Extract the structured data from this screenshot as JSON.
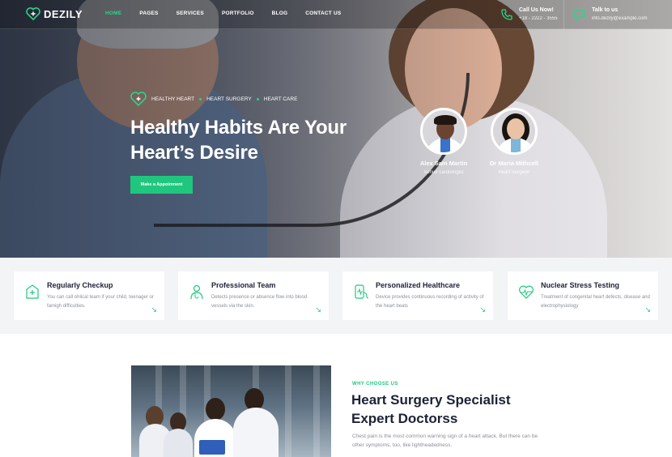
{
  "brand": {
    "name": "DEZILY"
  },
  "nav": {
    "items": [
      {
        "label": "HOME",
        "active": true
      },
      {
        "label": "PAGES"
      },
      {
        "label": "SERVICES"
      },
      {
        "label": "PORTFOLIO"
      },
      {
        "label": "BLOG"
      },
      {
        "label": "CONTACT US"
      }
    ]
  },
  "contact": {
    "phone": {
      "title": "Call Us Now!",
      "value": "+18 - 2222 - 3555",
      "icon": "phone-icon"
    },
    "email": {
      "title": "Talk to us",
      "value": "info.dezily@example.com",
      "icon": "chat-icon"
    }
  },
  "hero": {
    "crumbs": [
      "HEALTHY HEART",
      "HEART SURGERY",
      "HEART CARE"
    ],
    "title_line1": "Healthy Habits Are Your",
    "title_line2": "Heart’s Desire",
    "cta": "Make a Appoinment",
    "doctors": [
      {
        "name": "Alex Sam Martin",
        "role": "Senior cardiologist"
      },
      {
        "name": "Dr Maria Mithcell",
        "role": "Heart Surgeon"
      }
    ]
  },
  "features": [
    {
      "title": "Regularly Checkup",
      "desc": "You can call ohlical team if your child, teenager or famigh difficulties.",
      "icon": "checkup-icon"
    },
    {
      "title": "Professional Team",
      "desc": "Detects presence or absence flow into blood vessels via the skin.",
      "icon": "doctor-icon"
    },
    {
      "title": "Personalized Healthcare",
      "desc": "Device provides continuous recording of activity of the heart beats",
      "icon": "device-icon"
    },
    {
      "title": "Nuclear Stress Testing",
      "desc": "Treatment of congenital heart defects, disease and electrophysiology",
      "icon": "heart-pulse-icon"
    }
  ],
  "about": {
    "label": "WHY CHOOSE US",
    "title_line1": "Heart Surgery Specialist",
    "title_line2": "Expert Doctorss",
    "text": "Chest pain is the most common warning sign of a heart attack. But there can be other symptoms, too, like lightheadedness."
  },
  "colors": {
    "accent": "#1fc77e",
    "dark": "#1c2236",
    "muted": "#8a8f99"
  }
}
